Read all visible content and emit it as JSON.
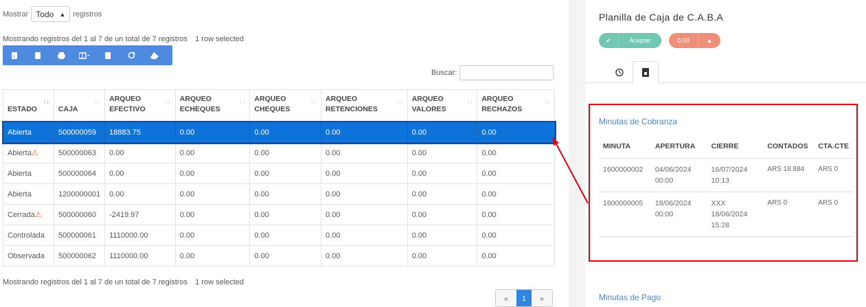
{
  "length_menu": {
    "prefix": "Mostrar",
    "selected": "Todo",
    "suffix": "registros"
  },
  "info_top": {
    "text": "Mostrando registros del 1 al 7 de un total de 7 registros",
    "selected": "1 row selected"
  },
  "info_bottom": {
    "text": "Mostrando registros del 1 al 7 de un total de 7 registros",
    "selected": "1 row selected"
  },
  "toolbar": {
    "icons": [
      "excel-icon",
      "csv-icon",
      "print-icon",
      "columns-icon",
      "pdf-icon",
      "refresh-icon",
      "eraser-icon"
    ]
  },
  "search": {
    "label": "Buscar:",
    "value": ""
  },
  "table": {
    "headers": [
      [
        "ESTADO",
        ""
      ],
      [
        "CAJA",
        ""
      ],
      [
        "ARQUEO",
        "EFECTIVO"
      ],
      [
        "ARQUEO",
        "ECHEQUES"
      ],
      [
        "ARQUEO",
        "CHEQUES"
      ],
      [
        "ARQUEO",
        "RETENCIONES"
      ],
      [
        "ARQUEO",
        "VALORES"
      ],
      [
        "ARQUEO",
        "RECHAZOS"
      ]
    ],
    "rows": [
      {
        "estado": "Abierta",
        "warn": false,
        "cells": [
          "500000059",
          "18883.75",
          "0.00",
          "0.00",
          "0.00",
          "0.00",
          "0.00"
        ],
        "selected": true
      },
      {
        "estado": "Abierta",
        "warn": true,
        "cells": [
          "500000063",
          "0.00",
          "0.00",
          "0.00",
          "0.00",
          "0.00",
          "0.00"
        ],
        "selected": false
      },
      {
        "estado": "Abierta",
        "warn": false,
        "cells": [
          "500000064",
          "0.00",
          "0.00",
          "0.00",
          "0.00",
          "0.00",
          "0.00"
        ],
        "selected": false
      },
      {
        "estado": "Abierta",
        "warn": false,
        "cells": [
          "1200000001",
          "0.00",
          "0.00",
          "0.00",
          "0.00",
          "0.00",
          "0.00"
        ],
        "selected": false
      },
      {
        "estado": "Cerrada",
        "warn": true,
        "cells": [
          "500000060",
          "-2419.97",
          "0.00",
          "0.00",
          "0.00",
          "0.00",
          "0.00"
        ],
        "selected": false
      },
      {
        "estado": "Controlada",
        "warn": false,
        "cells": [
          "500000061",
          "1110000.00",
          "0.00",
          "0.00",
          "0.00",
          "0.00",
          "0.00"
        ],
        "selected": false
      },
      {
        "estado": "Observada",
        "warn": false,
        "cells": [
          "500000062",
          "1110000.00",
          "0.00",
          "0.00",
          "0.00",
          "0.00",
          "0.00"
        ],
        "selected": false
      }
    ]
  },
  "pager": {
    "prev": "«",
    "current": "1",
    "next": "»"
  },
  "panel": {
    "title": "Planilla de Caja de C.A.B.A",
    "accept_label": "Aceptar",
    "amount": "0.00",
    "minutas_cobranza": {
      "title": "Minutas de Cobranza",
      "headers": [
        "MINUTA",
        "APERTURA",
        "CIERRE",
        "CONTADOS",
        "CTA.CTE"
      ],
      "rows": [
        [
          "1600000002",
          "04/06/2024 00:00",
          "16/07/2024 10:13",
          "ARS 18.884",
          "ARS 0"
        ],
        [
          "1600000005",
          "18/06/2024 00:00",
          "XXX 18/06/2024 15:28",
          "ARS 0",
          "ARS 0"
        ]
      ]
    },
    "minutas_pago_title": "Minutas de Pago"
  },
  "colors": {
    "selected_row": "#0d72d9",
    "toolbar": "#4e8be0",
    "accept": "#72c7b3",
    "amount": "#ee8f79",
    "highlight_box": "#e3000f",
    "link_title": "#4b86c8"
  }
}
